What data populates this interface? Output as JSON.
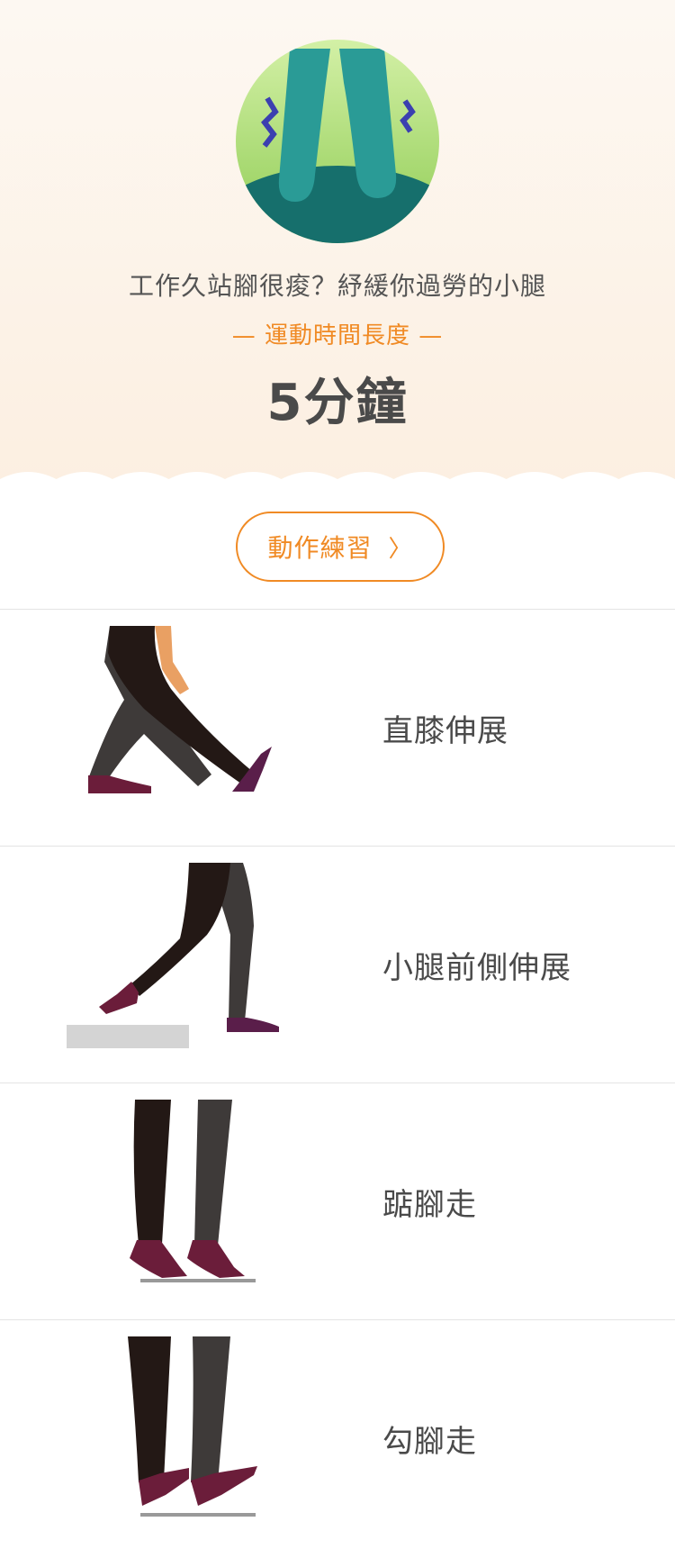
{
  "hero": {
    "icon": "sore-calves-icon",
    "subtitle": "工作久站腳很痠？紓緩你過勞的小腿",
    "duration_label": "— 運動時間長度 —",
    "duration_value": "5分鐘"
  },
  "cta": {
    "label": "動作練習",
    "icon": "chevron-right-icon",
    "chevron": "〉"
  },
  "exercises": [
    {
      "name": "直膝伸展",
      "icon": "straight-knee-stretch-illustration"
    },
    {
      "name": "小腿前側伸展",
      "icon": "front-calf-stretch-illustration"
    },
    {
      "name": "踮腳走",
      "icon": "tiptoe-walk-illustration"
    },
    {
      "name": "勾腳走",
      "icon": "heel-walk-illustration"
    }
  ],
  "colors": {
    "accent": "#f08a24",
    "leg_dark": "#231815",
    "leg_gray": "#3e3a39",
    "shoe": "#6b1d3a",
    "teal": "#2a9b96",
    "green": "#a8d96b"
  }
}
